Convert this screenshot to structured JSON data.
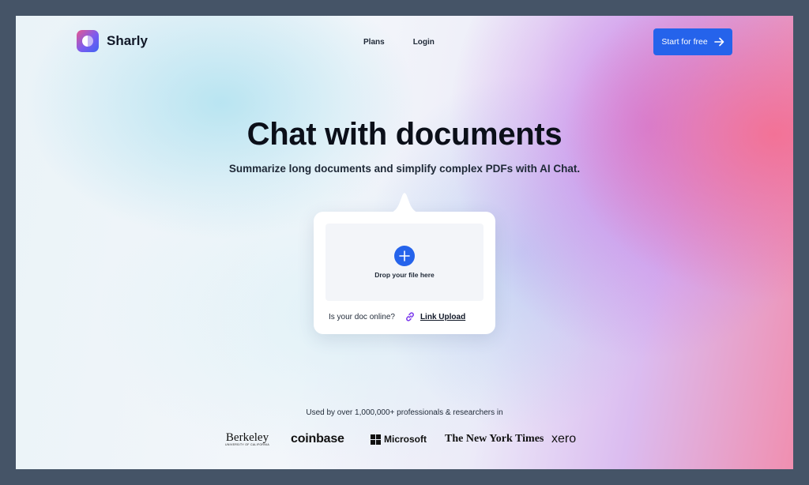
{
  "brand": {
    "name": "Sharly",
    "logo_icon": "sharly-logo-icon"
  },
  "nav": {
    "items": [
      {
        "label": "Plans"
      },
      {
        "label": "Login"
      }
    ]
  },
  "cta": {
    "label": "Start for free",
    "icon": "arrow-right-icon"
  },
  "hero": {
    "title": "Chat with documents",
    "subtitle": "Summarize long documents and simplify complex PDFs with AI Chat."
  },
  "upload": {
    "drop_label": "Drop your file here",
    "drop_icon": "plus-icon",
    "online_question": "Is your doc online?",
    "link_icon": "link-icon",
    "link_upload_label": "Link Upload"
  },
  "trust": {
    "text": "Used by over 1,000,000+ professionals & researchers in",
    "logos": [
      {
        "name": "Berkeley",
        "tagline": "UNIVERSITY OF CALIFORNIA"
      },
      {
        "name": "coinbase"
      },
      {
        "name": "Microsoft"
      },
      {
        "name": "The New York Times"
      },
      {
        "name": "xero"
      }
    ]
  },
  "colors": {
    "accent": "#2563eb",
    "frame": "#455467",
    "text": "#111827"
  }
}
